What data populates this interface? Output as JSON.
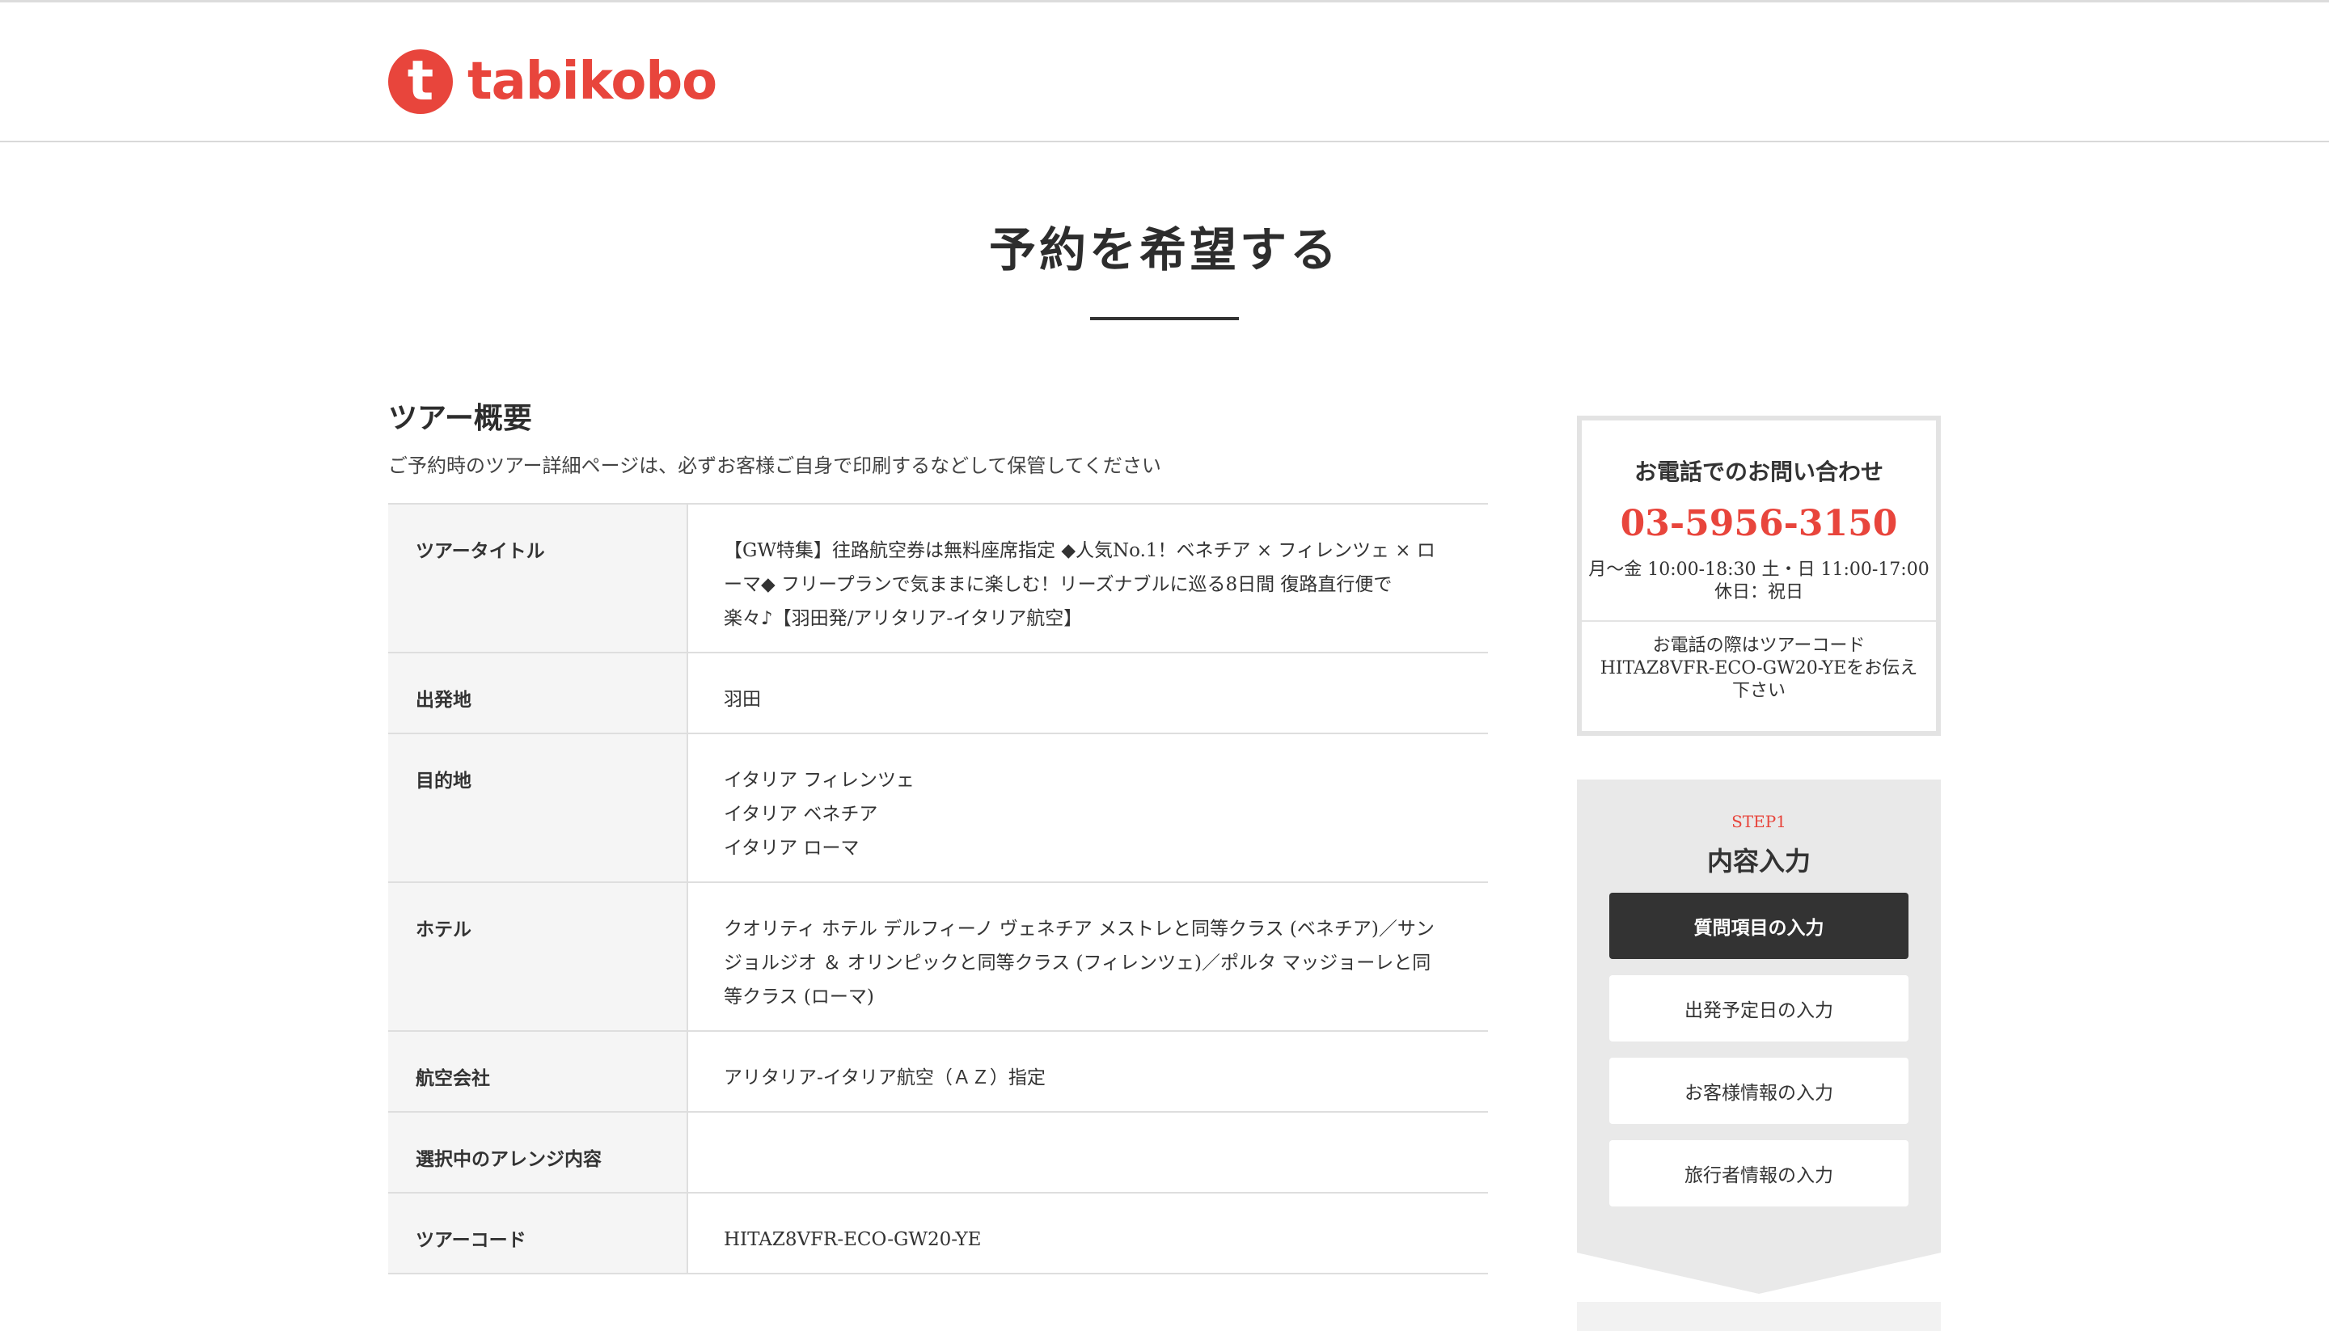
{
  "header": {
    "logo_mark": "t",
    "logo_text": "tabikobo"
  },
  "page": {
    "title": "予約を希望する"
  },
  "overview": {
    "title": "ツアー概要",
    "note": "ご予約時のツアー詳細ページは、必ずお客様ご自身で印刷するなどして保管してください",
    "rows": [
      {
        "label": "ツアータイトル",
        "lines": [
          "【GW特集】往路航空券は無料座席指定 ◆人気No.1！ベネチア × フィレンツェ × ロ",
          "ーマ◆ フリープランで気ままに楽しむ！リーズナブルに巡る8日間 復路直行便で",
          "楽々♪【羽田発/アリタリア-イタリア航空】"
        ]
      },
      {
        "label": "出発地",
        "lines": [
          "羽田"
        ]
      },
      {
        "label": "目的地",
        "lines": [
          "イタリア フィレンツェ",
          "イタリア ベネチア",
          "イタリア ローマ"
        ]
      },
      {
        "label": "ホテル",
        "lines": [
          "クオリティ ホテル デルフィーノ ヴェネチア メストレと同等クラス (ベネチア)／サン",
          "ジョルジオ ＆ オリンピックと同等クラス (フィレンツェ)／ポルタ マッジョーレと同",
          "等クラス (ローマ)"
        ]
      },
      {
        "label": "航空会社",
        "lines": [
          "アリタリア-イタリア航空（ＡＺ）指定"
        ]
      },
      {
        "label": "選択中のアレンジ内容",
        "lines": [
          ""
        ]
      },
      {
        "label": "ツアーコード",
        "lines": [
          "HITAZ8VFR-ECO-GW20-YE"
        ]
      }
    ]
  },
  "contact": {
    "heading": "お電話でのお問い合わせ",
    "phone": "03-5956-3150",
    "hours": "月〜金 10:00-18:30 土・日 11:00-17:00",
    "holiday": "休日：祝日",
    "note": "お電話の際はツアーコードHITAZ8VFR-ECO-GW20-YEをお伝え下さい"
  },
  "steps": {
    "label": "STEP1",
    "title": "内容入力",
    "items": [
      {
        "label": "質問項目の入力",
        "active": true
      },
      {
        "label": "出発予定日の入力",
        "active": false
      },
      {
        "label": "お客様情報の入力",
        "active": false
      },
      {
        "label": "旅行者情報の入力",
        "active": false
      }
    ]
  },
  "colors": {
    "brand": "#e8453c",
    "dark_button": "#333333",
    "panel": "#e9e9e9"
  }
}
